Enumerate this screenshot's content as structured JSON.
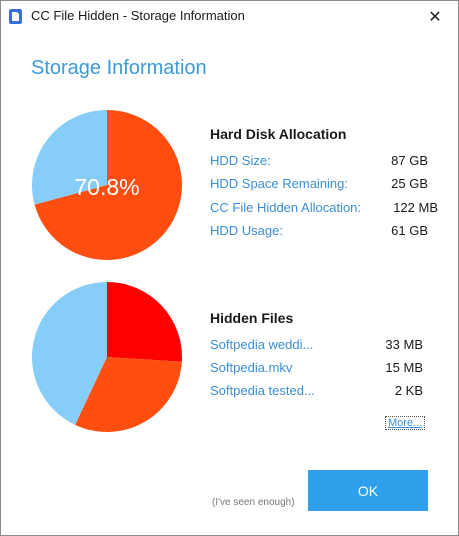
{
  "window": {
    "title": "CC File Hidden - Storage Information",
    "close_glyph": "✕"
  },
  "heading": "Storage Information",
  "disk": {
    "title": "Hard Disk Allocation",
    "rows": [
      {
        "label": "HDD Size:",
        "value": "87 GB"
      },
      {
        "label": "HDD Space Remaining:",
        "value": "25 GB"
      },
      {
        "label": "CC File Hidden Allocation:",
        "value": "122 MB"
      },
      {
        "label": "HDD Usage:",
        "value": "61 GB"
      }
    ],
    "pie_center_label": "70.8%",
    "pie": {
      "slices": [
        {
          "value": 70.8,
          "color": "#ff4e10"
        },
        {
          "value": 29.2,
          "color": "#87cdfa"
        }
      ]
    }
  },
  "hidden": {
    "title": "Hidden Files",
    "rows": [
      {
        "label": "Softpedia weddi...",
        "value": "33 MB"
      },
      {
        "label": "Softpedia.mkv",
        "value": "15 MB"
      },
      {
        "label": "Softpedia tested...",
        "value": "2 KB"
      }
    ],
    "more_label": "More...",
    "pie": {
      "slices": [
        {
          "value": 26,
          "color": "#ff0000"
        },
        {
          "value": 31,
          "color": "#ff4e10"
        },
        {
          "value": 43,
          "color": "#87cdfa"
        }
      ]
    }
  },
  "footer": {
    "note": "(I've seen enough)",
    "ok_label": "OK"
  }
}
